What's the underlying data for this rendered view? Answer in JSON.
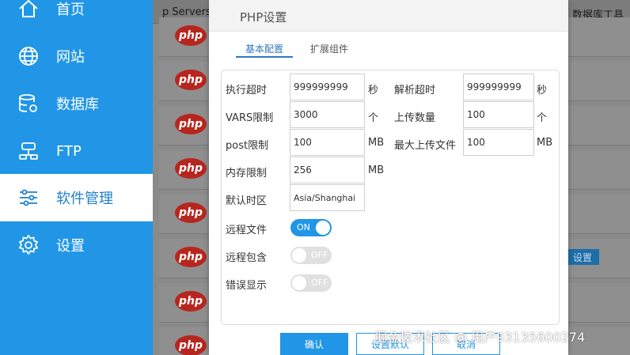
{
  "sidebar": {
    "items": [
      {
        "label": "首页",
        "icon": "home-icon"
      },
      {
        "label": "网站",
        "icon": "globe-icon"
      },
      {
        "label": "数据库",
        "icon": "database-icon"
      },
      {
        "label": "FTP",
        "icon": "ftp-server-icon"
      },
      {
        "label": "软件管理",
        "icon": "sliders-icon"
      },
      {
        "label": "设置",
        "icon": "gear-icon"
      }
    ],
    "active_index": 4
  },
  "background": {
    "header_left": "p Servers",
    "header_right": "数据库工具",
    "logo_text": "php",
    "settings_button": "设置"
  },
  "dialog": {
    "title": "PHP设置",
    "tabs": [
      {
        "label": "基本配置"
      },
      {
        "label": "扩展组件"
      }
    ],
    "fields": {
      "exec_timeout": {
        "label": "执行超时",
        "value": "999999999",
        "unit": "秒"
      },
      "parse_timeout": {
        "label": "解析超时",
        "value": "999999999",
        "unit": "秒"
      },
      "vars_limit": {
        "label": "VARS限制",
        "value": "3000",
        "unit": "个"
      },
      "upload_count": {
        "label": "上传数量",
        "value": "100",
        "unit": "个"
      },
      "post_limit": {
        "label": "post限制",
        "value": "100",
        "unit": "MB"
      },
      "max_upload": {
        "label": "最大上传文件",
        "value": "100",
        "unit": "MB"
      },
      "memory_limit": {
        "label": "内存限制",
        "value": "256",
        "unit": "MB"
      },
      "timezone": {
        "label": "默认时区",
        "value": "Asia/Shanghai"
      }
    },
    "toggles": {
      "remote_file": {
        "label": "远程文件",
        "state": "ON"
      },
      "remote_include": {
        "label": "远程包含",
        "state": "OFF"
      },
      "error_display": {
        "label": "错误显示",
        "state": "OFF"
      }
    },
    "buttons": {
      "confirm": "确认",
      "set_default": "设置默认",
      "cancel": "取消"
    }
  },
  "watermark": "掘金技术社区 @ 用户93135600274",
  "colors": {
    "accent": "#2196e6",
    "tab_active": "#2f78c3",
    "php_logo": "#b7261e"
  }
}
